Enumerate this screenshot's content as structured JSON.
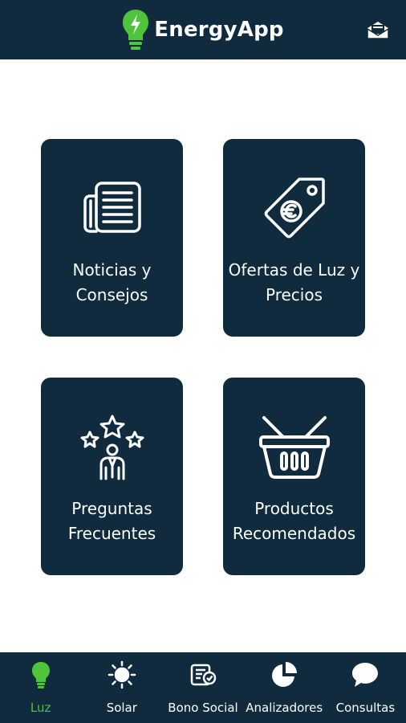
{
  "header": {
    "app_name": "EnergyApp",
    "logo_icon": "lightbulb-bolt-icon",
    "mail_icon": "open-envelope-icon"
  },
  "cards": [
    {
      "label": "Noticias y\nConsejos",
      "icon": "newspaper-icon"
    },
    {
      "label": "Ofertas de Luz y\nPrecios",
      "icon": "euro-price-tag-icon"
    },
    {
      "label": "Preguntas\nFrecuentes",
      "icon": "person-stars-icon"
    },
    {
      "label": "Productos\nRecomendados",
      "icon": "shopping-basket-icon"
    }
  ],
  "tabs": [
    {
      "label": "Luz",
      "icon": "lightbulb-icon",
      "active": true
    },
    {
      "label": "Solar",
      "icon": "sun-icon"
    },
    {
      "label": "Bono Social",
      "icon": "social-card-icon"
    },
    {
      "label": "Analizadores",
      "icon": "pie-chart-icon"
    },
    {
      "label": "Consultas",
      "icon": "chat-bubble-icon"
    }
  ],
  "colors": {
    "primary": "#0f2b3d",
    "accent": "#4fc33a",
    "text_on_dark": "#ffffff",
    "background": "#ffffff"
  }
}
